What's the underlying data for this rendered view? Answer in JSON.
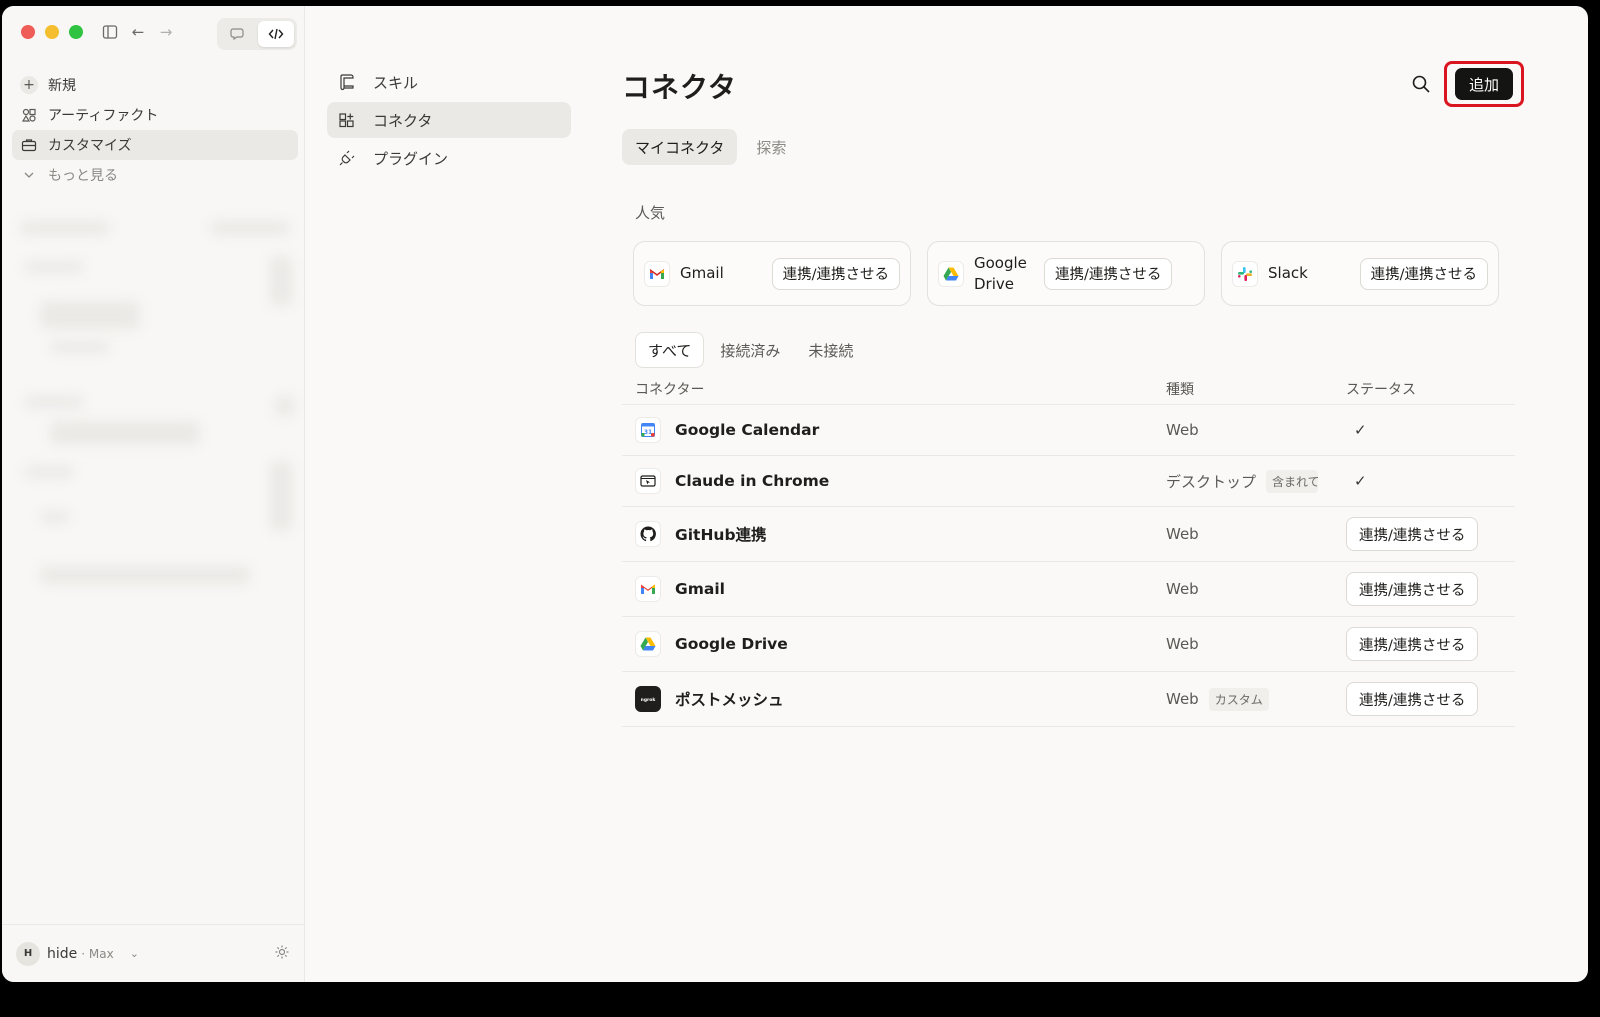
{
  "sidebar": {
    "nav": [
      {
        "label": "新規",
        "icon": "plus-icon"
      },
      {
        "label": "アーティファクト",
        "icon": "artifacts-icon"
      },
      {
        "label": "カスタマイズ",
        "icon": "briefcase-icon"
      },
      {
        "label": "もっと見る",
        "icon": "chevron-down-icon"
      }
    ],
    "user": {
      "initial": "H",
      "name": "hide",
      "plan": "· Max"
    }
  },
  "subnav": [
    {
      "label": "スキル",
      "icon": "scroll-icon"
    },
    {
      "label": "コネクタ",
      "icon": "grid-plus-icon"
    },
    {
      "label": "プラグイン",
      "icon": "plug-icon"
    }
  ],
  "main": {
    "title": "コネクタ",
    "add_label": "追加",
    "tabs": [
      "マイコネクタ",
      "探索"
    ],
    "popular_label": "人気",
    "popular": [
      {
        "name": "Gmail",
        "icon": "gmail-icon",
        "action": "連携/連携させる"
      },
      {
        "name": "Google Drive",
        "icon": "google-drive-icon",
        "action": "連携/連携させる"
      },
      {
        "name": "Slack",
        "icon": "slack-icon",
        "action": "連携/連携させる"
      }
    ],
    "filters": [
      "すべて",
      "接続済み",
      "未接続"
    ],
    "columns": {
      "name": "コネクター",
      "type": "種類",
      "status": "ステータス"
    },
    "rows": [
      {
        "name": "Google Calendar",
        "icon": "google-calendar-icon",
        "type": "Web",
        "badge": "",
        "status": "✓"
      },
      {
        "name": "Claude in Chrome",
        "icon": "browser-cursor-icon",
        "type": "デスクトップ",
        "badge": "含まれて",
        "status": "✓"
      },
      {
        "name": "GitHub連携",
        "icon": "github-icon",
        "type": "Web",
        "badge": "",
        "action": "連携/連携させる"
      },
      {
        "name": "Gmail",
        "icon": "gmail-icon",
        "type": "Web",
        "badge": "",
        "action": "連携/連携させる"
      },
      {
        "name": "Google Drive",
        "icon": "google-drive-icon",
        "type": "Web",
        "badge": "",
        "action": "連携/連携させる"
      },
      {
        "name": "ポストメッシュ",
        "icon": "ngrok-icon",
        "type": "Web",
        "badge": "カスタム",
        "action": "連携/連携させる"
      }
    ]
  },
  "colors": {
    "accent": "#141413",
    "highlight": "#d9151f"
  }
}
